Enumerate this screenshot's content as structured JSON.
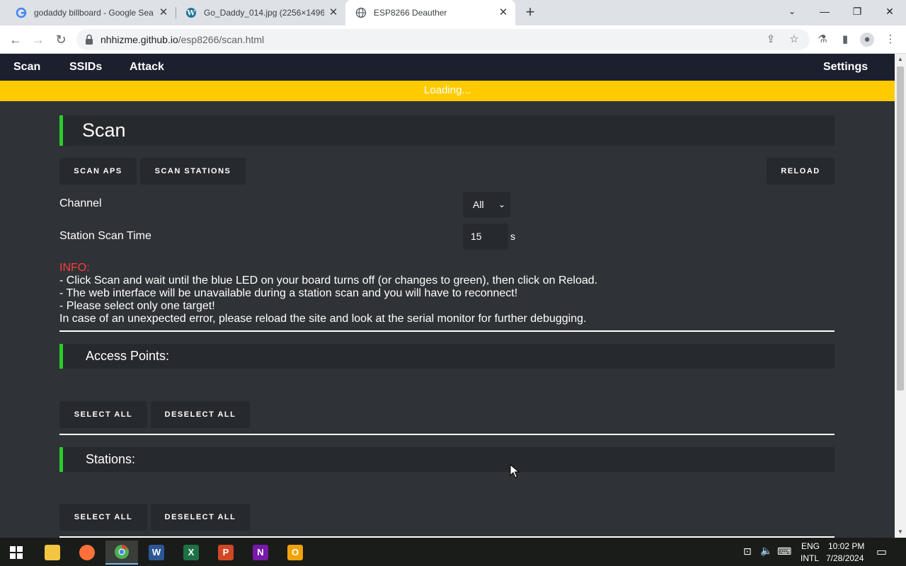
{
  "browser": {
    "tabs": [
      {
        "title": "godaddy billboard - Google Sea",
        "favicon": "google-icon"
      },
      {
        "title": "Go_Daddy_014.jpg (2256×1496)",
        "favicon": "wordpress-icon"
      },
      {
        "title": "ESP8266 Deauther",
        "favicon": "globe-icon",
        "active": true
      }
    ],
    "url_host": "nhhizme.github.io",
    "url_path": "/esp8266/scan.html"
  },
  "nav": {
    "items": [
      "Scan",
      "SSIDs",
      "Attack"
    ],
    "settings": "Settings"
  },
  "loading": "Loading...",
  "page": {
    "title": "Scan",
    "scan_aps": "SCAN APS",
    "scan_stations": "SCAN STATIONS",
    "reload": "RELOAD",
    "channel_label": "Channel",
    "channel_value": "All",
    "scan_time_label": "Station Scan Time",
    "scan_time_value": "15",
    "scan_time_unit": "s",
    "info": {
      "label": "INFO:",
      "lines": [
        "- Click Scan and wait until the blue LED on your board turns off (or changes to green), then click on Reload.",
        "- The web interface will be unavailable during a station scan and you will have to reconnect!",
        "- Please select only one target!",
        "In case of an unexpected error, please reload the site and look at the serial monitor for further debugging."
      ]
    },
    "access_points": {
      "title": "Access Points:",
      "select_all": "SELECT ALL",
      "deselect_all": "DESELECT ALL"
    },
    "stations": {
      "title": "Stations:",
      "select_all": "SELECT ALL",
      "deselect_all": "DESELECT ALL"
    }
  },
  "taskbar": {
    "apps": [
      "File Explorer",
      "Firefox",
      "Chrome",
      "Word",
      "Excel",
      "PowerPoint",
      "OneNote",
      "Outlook"
    ],
    "lang_top": "ENG",
    "lang_bottom": "INTL",
    "time": "10:02 PM",
    "date": "7/28/2024"
  },
  "colors": {
    "accent_green": "#2bcc2b",
    "loading_yellow": "#ffcb00",
    "info_red": "#ff3b3b",
    "page_bg": "#2f3337",
    "nav_bg": "#1c1f2e"
  }
}
